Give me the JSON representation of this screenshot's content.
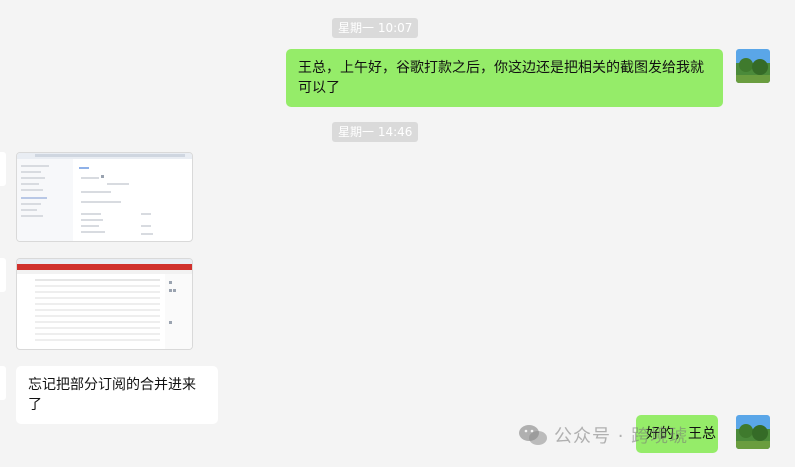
{
  "timestamps": [
    "星期一 10:07",
    "星期一 14:46"
  ],
  "messages": {
    "outgoing_1": "王总，上午好，谷歌打款之后，你这边还是把相关的截图发给我就可以了",
    "incoming_text": "忘记把部分订阅的合并进来了",
    "outgoing_2": "好的，王总"
  },
  "watermark": {
    "text": "公众号 · 跨境琥",
    "icon": "wechat-icon"
  },
  "colors": {
    "background": "#f4f4f4",
    "outgoing_bubble": "#95ec69",
    "incoming_bubble": "#ffffff",
    "time_chip": "#dadada",
    "thumb2_header": "#d0312d"
  }
}
